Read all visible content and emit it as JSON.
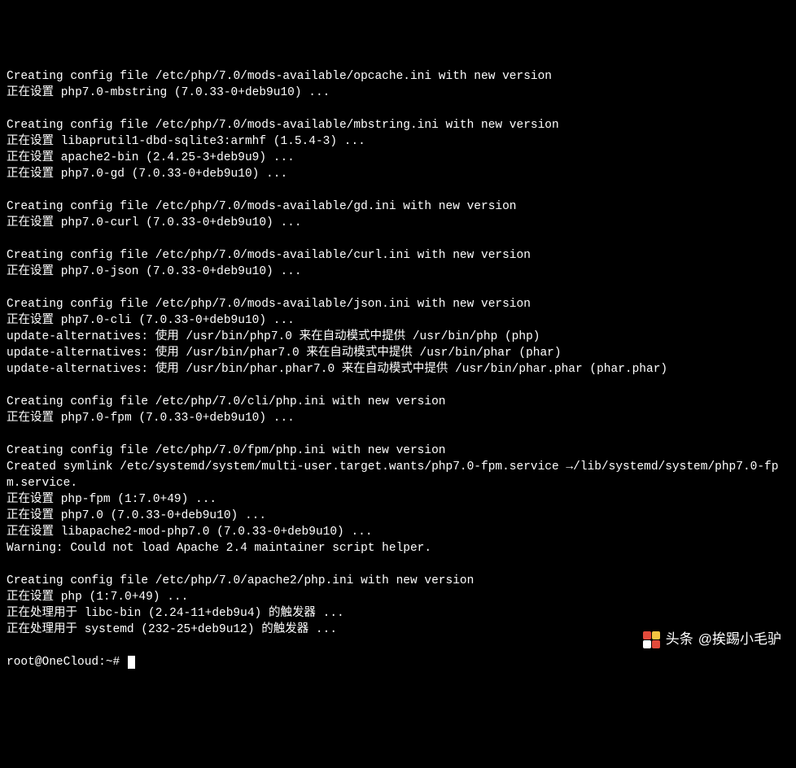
{
  "terminal": {
    "lines": [
      "Creating config file /etc/php/7.0/mods-available/opcache.ini with new version",
      "正在设置 php7.0-mbstring (7.0.33-0+deb9u10) ...",
      "",
      "Creating config file /etc/php/7.0/mods-available/mbstring.ini with new version",
      "正在设置 libaprutil1-dbd-sqlite3:armhf (1.5.4-3) ...",
      "正在设置 apache2-bin (2.4.25-3+deb9u9) ...",
      "正在设置 php7.0-gd (7.0.33-0+deb9u10) ...",
      "",
      "Creating config file /etc/php/7.0/mods-available/gd.ini with new version",
      "正在设置 php7.0-curl (7.0.33-0+deb9u10) ...",
      "",
      "Creating config file /etc/php/7.0/mods-available/curl.ini with new version",
      "正在设置 php7.0-json (7.0.33-0+deb9u10) ...",
      "",
      "Creating config file /etc/php/7.0/mods-available/json.ini with new version",
      "正在设置 php7.0-cli (7.0.33-0+deb9u10) ...",
      "update-alternatives: 使用 /usr/bin/php7.0 来在自动模式中提供 /usr/bin/php (php)",
      "update-alternatives: 使用 /usr/bin/phar7.0 来在自动模式中提供 /usr/bin/phar (phar)",
      "update-alternatives: 使用 /usr/bin/phar.phar7.0 来在自动模式中提供 /usr/bin/phar.phar (phar.phar)",
      "",
      "Creating config file /etc/php/7.0/cli/php.ini with new version",
      "正在设置 php7.0-fpm (7.0.33-0+deb9u10) ...",
      "",
      "Creating config file /etc/php/7.0/fpm/php.ini with new version",
      "Created symlink /etc/systemd/system/multi-user.target.wants/php7.0-fpm.service →/lib/systemd/system/php7.0-fpm.service.",
      "正在设置 php-fpm (1:7.0+49) ...",
      "正在设置 php7.0 (7.0.33-0+deb9u10) ...",
      "正在设置 libapache2-mod-php7.0 (7.0.33-0+deb9u10) ...",
      "Warning: Could not load Apache 2.4 maintainer script helper.",
      "",
      "Creating config file /etc/php/7.0/apache2/php.ini with new version",
      "正在设置 php (1:7.0+49) ...",
      "正在处理用于 libc-bin (2.24-11+deb9u4) 的触发器 ...",
      "正在处理用于 systemd (232-25+deb9u12) 的触发器 ..."
    ],
    "prompt": "root@OneCloud:~#"
  },
  "watermark": {
    "prefix": "头条",
    "handle": "@挨踢小毛驴"
  }
}
